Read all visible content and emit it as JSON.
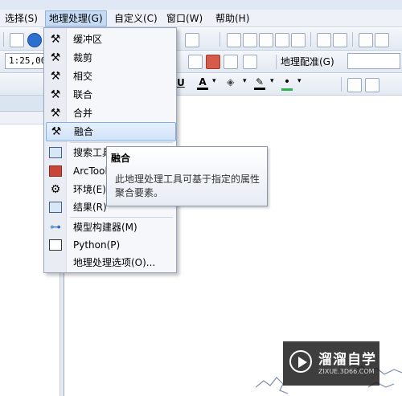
{
  "menubar": {
    "items": [
      "选择(S)",
      "地理处理(G)",
      "自定义(C)",
      "窗口(W)",
      "帮助(H)"
    ]
  },
  "toolbar": {
    "scale_value": "1:25,00",
    "georef_label": "地理配准(G)"
  },
  "dropdown": {
    "items": [
      {
        "label": "缓冲区",
        "icon": "hammer-icon"
      },
      {
        "label": "裁剪",
        "icon": "hammer-icon"
      },
      {
        "label": "相交",
        "icon": "hammer-icon"
      },
      {
        "label": "联合",
        "icon": "hammer-icon"
      },
      {
        "label": "合并",
        "icon": "hammer-icon"
      },
      {
        "label": "融合",
        "icon": "hammer-icon",
        "highlighted": true
      },
      {
        "label": "搜索工具",
        "icon": "search-window-icon"
      },
      {
        "label": "ArcToolbox",
        "icon": "arctoolbox-icon"
      },
      {
        "label": "环境(E)...",
        "icon": "tools-icon"
      },
      {
        "label": "结果(R)",
        "icon": "results-icon"
      },
      {
        "label": "模型构建器(M)",
        "icon": "model-builder-icon"
      },
      {
        "label": "Python(P)",
        "icon": "python-console-icon"
      },
      {
        "label": "地理处理选项(O)...",
        "icon": ""
      }
    ]
  },
  "tooltip": {
    "title": "融合",
    "body": "此地理处理工具可基于指定的属性聚合要素。"
  },
  "watermark": {
    "title": "溜溜自学",
    "url": "ZIXUE.3D66.COM"
  }
}
